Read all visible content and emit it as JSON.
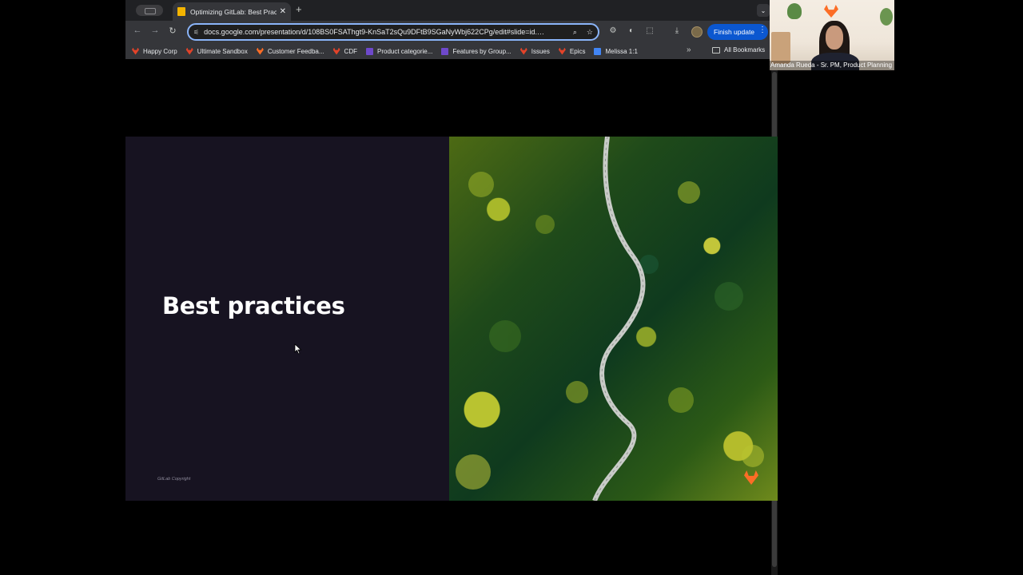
{
  "browser": {
    "tab": {
      "title": "Optimizing GitLab: Best Practices",
      "close": "✕"
    },
    "new_tab": "+",
    "tab_search": "⌄",
    "nav": {
      "back": "←",
      "forward": "→",
      "reload": "↻"
    },
    "omnibox": {
      "url": "docs.google.com/presentation/d/108BS0FSAThgt9-KnSaT2sQu9DFtB9SGaNyWbj622CPg/edit#slide=id.…",
      "zoom_icon": "⌕",
      "star_icon": "☆"
    },
    "toolbar_icons": [
      "⚙",
      "◐",
      "⬚",
      "⤓"
    ],
    "finish_update": "Finish update",
    "menu": "⋮"
  },
  "bookmarks": {
    "items": [
      {
        "label": "Happy Corp",
        "icon": "gitlab-fox"
      },
      {
        "label": "Ultimate Sandbox",
        "icon": "gitlab-fox"
      },
      {
        "label": "Customer Feedba...",
        "icon": "gitlab-fox-orange"
      },
      {
        "label": "CDF",
        "icon": "gitlab-fox"
      },
      {
        "label": "Product categorie...",
        "icon": "purple-square"
      },
      {
        "label": "Features by Group...",
        "icon": "purple-square"
      },
      {
        "label": "Issues",
        "icon": "gitlab-fox"
      },
      {
        "label": "Epics",
        "icon": "gitlab-fox"
      },
      {
        "label": "Melissa 1:1",
        "icon": "docs-blue"
      }
    ],
    "more": "»",
    "all_bookmarks": "All Bookmarks"
  },
  "slide": {
    "title": "Best practices",
    "footer": "GitLab Copyright"
  },
  "webcam": {
    "label": "Amanda Rueda - Sr. PM, Product Planning"
  }
}
